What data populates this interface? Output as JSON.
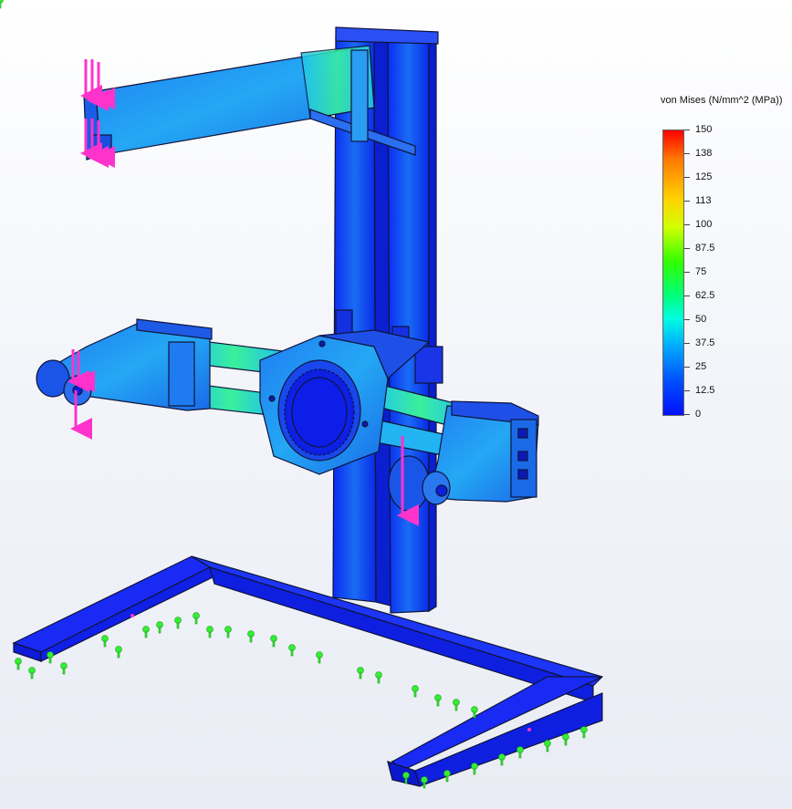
{
  "legend": {
    "title": "von Mises (N/mm^2 (MPa))",
    "ticks": [
      "150",
      "138",
      "125",
      "113",
      "100",
      "87.5",
      "75",
      "62.5",
      "50",
      "37.5",
      "25",
      "12.5",
      "0"
    ]
  },
  "colors": {
    "load_arrow": "#ff33cc",
    "fixture": "#33ee33",
    "low_stress": "#1030ff",
    "edge": "#10143a"
  },
  "model": {
    "load_arrows": 4,
    "fixtures": "green fixed-geometry markers along base"
  }
}
